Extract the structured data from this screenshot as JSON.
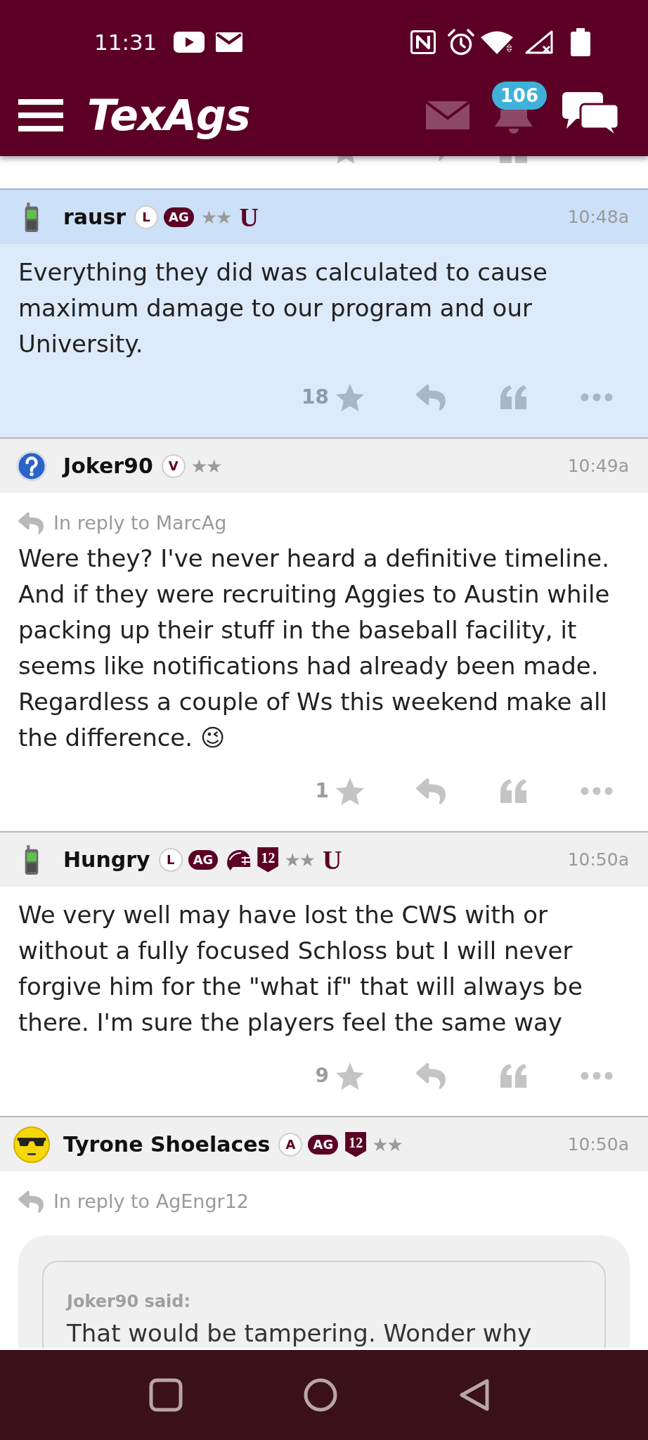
{
  "status_bar": {
    "time": "11:31"
  },
  "app_bar": {
    "logo": "TexAgs",
    "notification_count": "106"
  },
  "posts": [
    {
      "username": "rausr",
      "avatar": {
        "kind": "phone"
      },
      "highlighted": true,
      "badges": [
        {
          "kind": "circle",
          "text": "L"
        },
        {
          "kind": "pill",
          "text": "AG"
        },
        {
          "kind": "stars",
          "text": "★★"
        },
        {
          "kind": "letter",
          "text": "U"
        }
      ],
      "time": "10:48a",
      "body": "Everything they did was calculated to cause maximum damage to our program and our University.",
      "star_count": "18"
    },
    {
      "username": "Joker90",
      "avatar": {
        "kind": "question"
      },
      "highlighted": false,
      "badges": [
        {
          "kind": "circle",
          "text": "V"
        },
        {
          "kind": "stars",
          "text": "★★"
        }
      ],
      "time": "10:49a",
      "reply_to": "In reply to MarcAg",
      "body": "Were they? I've never heard a definitive timeline. And if they were recruiting Aggies to Austin while packing up their stuff in the baseball facility, it seems like notifications had already been made. Regardless a couple of Ws this weekend make all the difference. 😉",
      "star_count": "1"
    },
    {
      "username": "Hungry",
      "avatar": {
        "kind": "phone"
      },
      "highlighted": false,
      "badges": [
        {
          "kind": "circle",
          "text": "L"
        },
        {
          "kind": "pill",
          "text": "AG"
        },
        {
          "kind": "helmet"
        },
        {
          "kind": "shield",
          "text": "12"
        },
        {
          "kind": "stars",
          "text": "★★"
        },
        {
          "kind": "letter",
          "text": "U"
        }
      ],
      "time": "10:50a",
      "body": "We very well may have lost the CWS with or without a fully focused Schloss but I will never forgive him for the \"what if\" that will always be there. I'm sure the players feel the same way",
      "star_count": "9"
    },
    {
      "username": "Tyrone Shoelaces",
      "avatar": {
        "kind": "sunglasses"
      },
      "highlighted": false,
      "badges": [
        {
          "kind": "circle",
          "text": "A"
        },
        {
          "kind": "pill",
          "text": "AG"
        },
        {
          "kind": "shield",
          "text": "12"
        },
        {
          "kind": "stars",
          "text": "★★"
        }
      ],
      "time": "10:50a",
      "reply_to": "In reply to AgEngr12",
      "quote": {
        "attribution": "Joker90 said:",
        "text": "That would be tampering. Wonder why"
      }
    }
  ]
}
